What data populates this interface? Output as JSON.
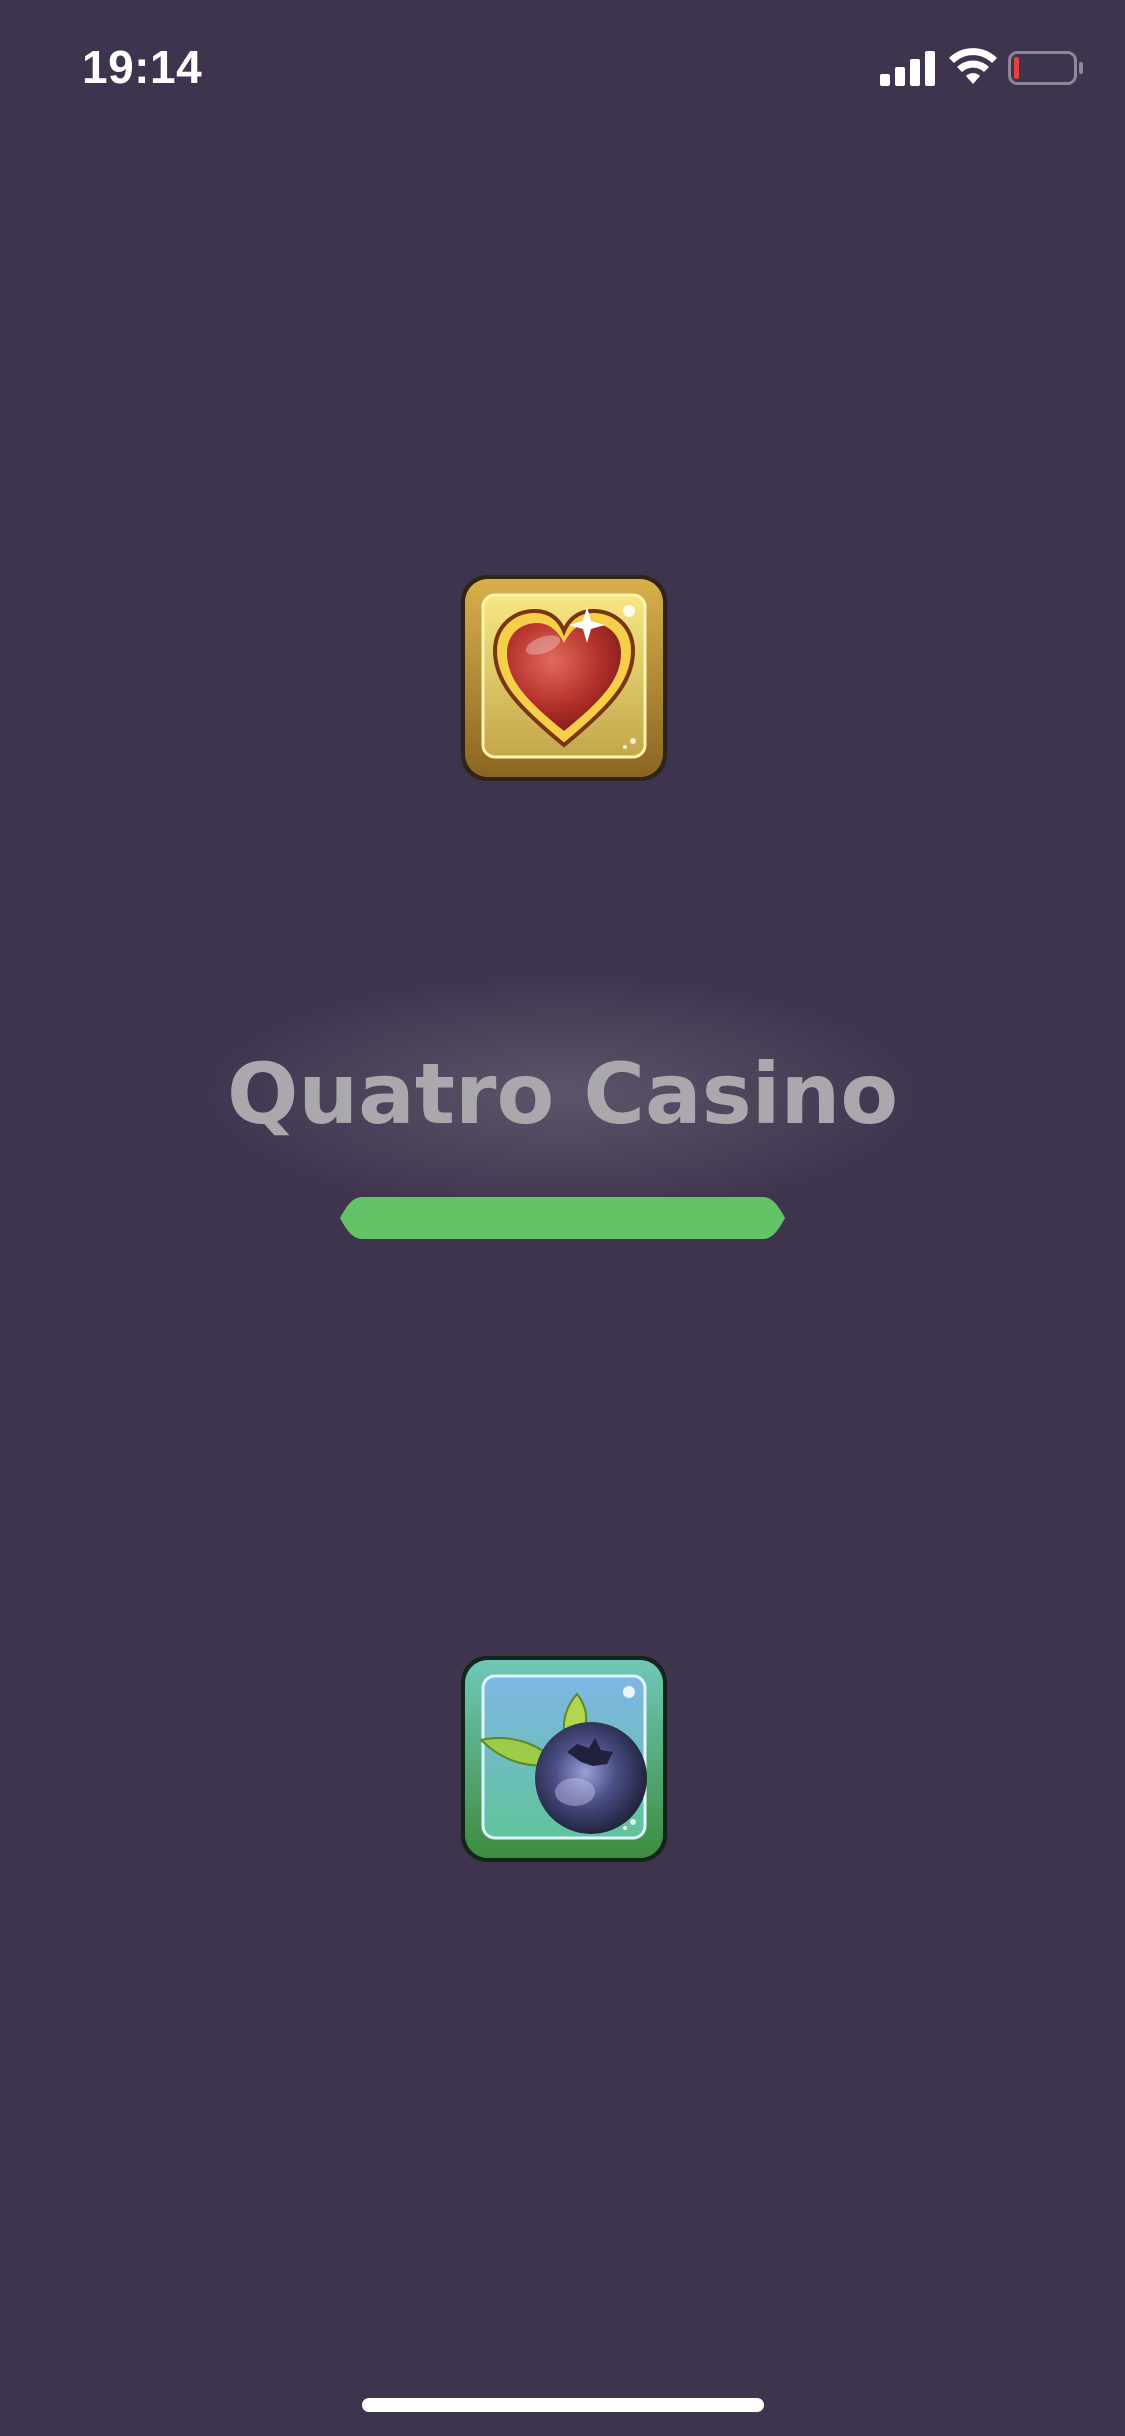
{
  "status_bar": {
    "time": "19:14",
    "icons": [
      "cellular-signal-icon",
      "wifi-icon",
      "battery-low-icon"
    ],
    "battery_color": "#e0433a"
  },
  "splash": {
    "title": "Quatro Casino",
    "top_icon": "heart-tile-icon",
    "bottom_icon": "blueberry-tile-icon",
    "progress": 1.0,
    "progress_color": "#62c466"
  },
  "colors": {
    "background": "#3e344e",
    "title_text": "#aba8ad"
  }
}
